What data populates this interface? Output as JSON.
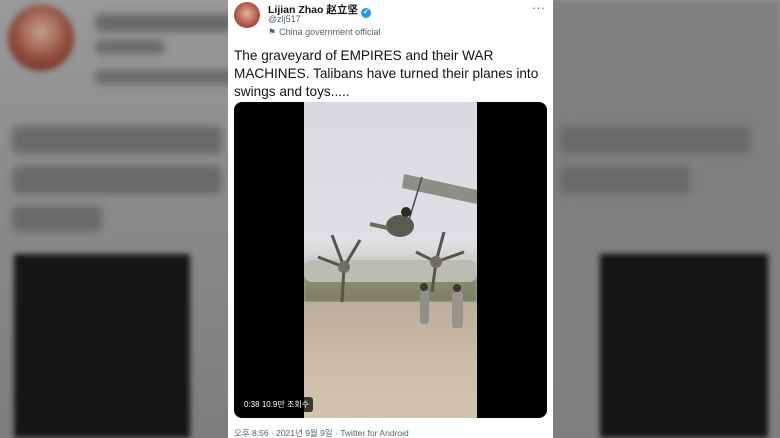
{
  "tweet": {
    "display_name": "Lijian Zhao 赵立坚",
    "handle": "@zlj517",
    "account_label": "China government official",
    "text": "The graveyard of EMPIRES and their WAR MACHINES. Talibans have turned their planes into swings and toys.....",
    "more_label": "···",
    "video": {
      "duration": "0:38",
      "views": "10.9만 조회수"
    },
    "timestamp": "오후 8:56 · 2021년 9월 9일 · Twitter for Android"
  },
  "colors": {
    "verified": "#1d9bf0",
    "text_primary": "#0f1419",
    "text_secondary": "#536471"
  },
  "icons": [
    "verified-badge-icon",
    "government-flag-icon",
    "more-options-icon"
  ]
}
